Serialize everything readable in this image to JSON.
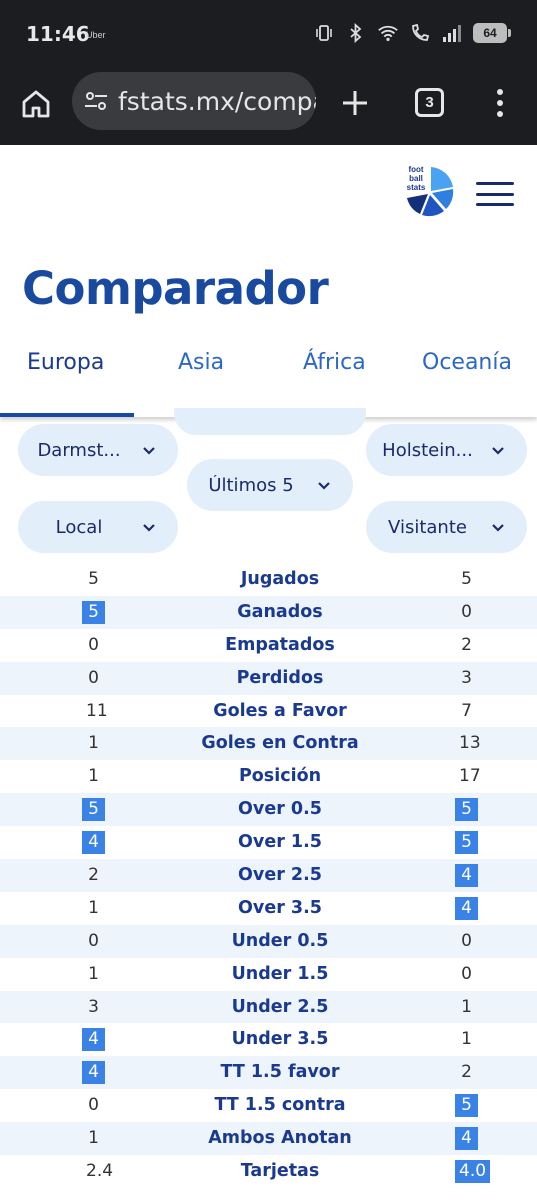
{
  "status_bar": {
    "time": "11:46",
    "carrier": "Uber",
    "battery": "64",
    "icons": [
      "vibrate-icon",
      "bluetooth-icon",
      "wifi-icon",
      "wifi-call-icon",
      "signal-icon",
      "battery-icon"
    ]
  },
  "browser": {
    "url": "fstats.mx/comparador",
    "tab_count": "3"
  },
  "site": {
    "logo_text": "foot\nball\nstats",
    "accent": "#1a4aa0"
  },
  "page": {
    "title": "Comparador"
  },
  "region_tabs": [
    {
      "label": "Europa",
      "active": true
    },
    {
      "label": "Asia",
      "active": false
    },
    {
      "label": "África",
      "active": false
    },
    {
      "label": "Oceanía",
      "active": false
    }
  ],
  "filters": {
    "home_team": "Darmst...",
    "away_team": "Holstein...",
    "range": "Últimos 5",
    "home_venue": "Local",
    "away_venue": "Visitante"
  },
  "stats": [
    {
      "label": "Jugados",
      "local": "5",
      "visitor": "5",
      "local_hl": false,
      "visitor_hl": false
    },
    {
      "label": "Ganados",
      "local": "5",
      "visitor": "0",
      "local_hl": true,
      "visitor_hl": false
    },
    {
      "label": "Empatados",
      "local": "0",
      "visitor": "2",
      "local_hl": false,
      "visitor_hl": false
    },
    {
      "label": "Perdidos",
      "local": "0",
      "visitor": "3",
      "local_hl": false,
      "visitor_hl": false
    },
    {
      "label": "Goles a Favor",
      "local": "11",
      "visitor": "7",
      "local_hl": false,
      "visitor_hl": false
    },
    {
      "label": "Goles en Contra",
      "local": "1",
      "visitor": "13",
      "local_hl": false,
      "visitor_hl": false
    },
    {
      "label": "Posición",
      "local": "1",
      "visitor": "17",
      "local_hl": false,
      "visitor_hl": false
    },
    {
      "label": "Over 0.5",
      "local": "5",
      "visitor": "5",
      "local_hl": true,
      "visitor_hl": true
    },
    {
      "label": "Over 1.5",
      "local": "4",
      "visitor": "5",
      "local_hl": true,
      "visitor_hl": true
    },
    {
      "label": "Over 2.5",
      "local": "2",
      "visitor": "4",
      "local_hl": false,
      "visitor_hl": true
    },
    {
      "label": "Over 3.5",
      "local": "1",
      "visitor": "4",
      "local_hl": false,
      "visitor_hl": true
    },
    {
      "label": "Under 0.5",
      "local": "0",
      "visitor": "0",
      "local_hl": false,
      "visitor_hl": false
    },
    {
      "label": "Under 1.5",
      "local": "1",
      "visitor": "0",
      "local_hl": false,
      "visitor_hl": false
    },
    {
      "label": "Under 2.5",
      "local": "3",
      "visitor": "1",
      "local_hl": false,
      "visitor_hl": false
    },
    {
      "label": "Under 3.5",
      "local": "4",
      "visitor": "1",
      "local_hl": true,
      "visitor_hl": false
    },
    {
      "label": "TT 1.5 favor",
      "local": "4",
      "visitor": "2",
      "local_hl": true,
      "visitor_hl": false
    },
    {
      "label": "TT 1.5 contra",
      "local": "0",
      "visitor": "5",
      "local_hl": false,
      "visitor_hl": true
    },
    {
      "label": "Ambos Anotan",
      "local": "1",
      "visitor": "4",
      "local_hl": false,
      "visitor_hl": true
    },
    {
      "label": "Tarjetas",
      "local": "2.4",
      "visitor": "4.0",
      "local_hl": false,
      "visitor_hl": true
    }
  ]
}
